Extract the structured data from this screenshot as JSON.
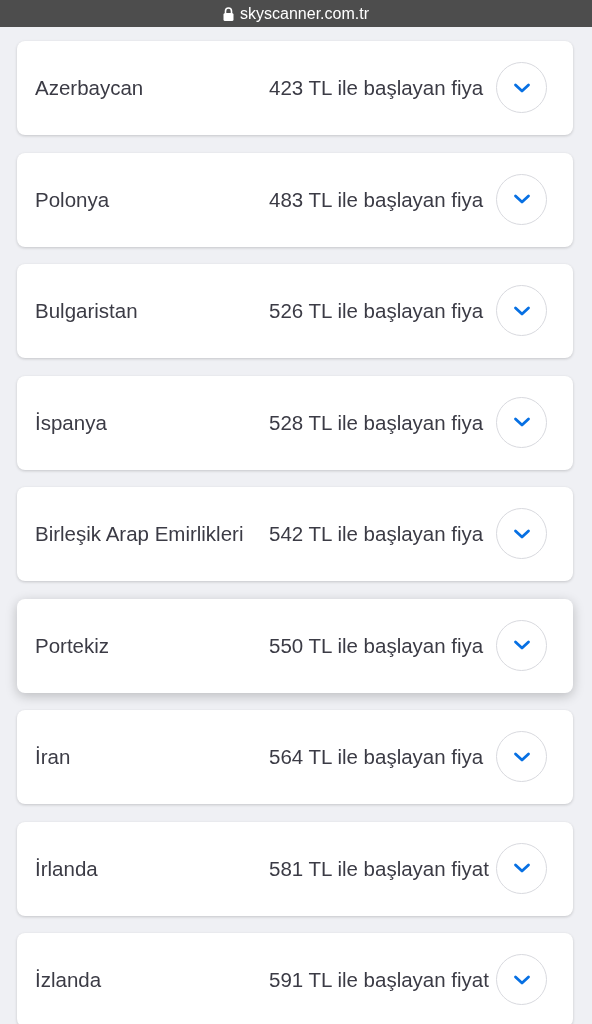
{
  "address_bar": {
    "url": "skyscanner.com.tr"
  },
  "destinations": [
    {
      "name": "Azerbaycan",
      "price": "423 TL ile başlayan fiya",
      "expanded": false,
      "raised": false
    },
    {
      "name": "Polonya",
      "price": "483 TL ile başlayan fiya",
      "expanded": false,
      "raised": false
    },
    {
      "name": "Bulgaristan",
      "price": "526 TL ile başlayan fiya",
      "expanded": false,
      "raised": false
    },
    {
      "name": "İspanya",
      "price": "528 TL ile başlayan fiya",
      "expanded": false,
      "raised": false
    },
    {
      "name": "Birleşik Arap Emirlikleri",
      "price": "542 TL ile başlayan fiya",
      "expanded": false,
      "raised": false
    },
    {
      "name": "Portekiz",
      "price": "550 TL ile başlayan fiya",
      "expanded": false,
      "raised": true
    },
    {
      "name": "İran",
      "price": "564 TL ile başlayan fiya",
      "expanded": false,
      "raised": false
    },
    {
      "name": "İrlanda",
      "price": "581 TL ile başlayan fiyat",
      "expanded": false,
      "raised": false
    },
    {
      "name": "İzlanda",
      "price": "591 TL ile başlayan fiyat",
      "expanded": false,
      "raised": false
    }
  ]
}
